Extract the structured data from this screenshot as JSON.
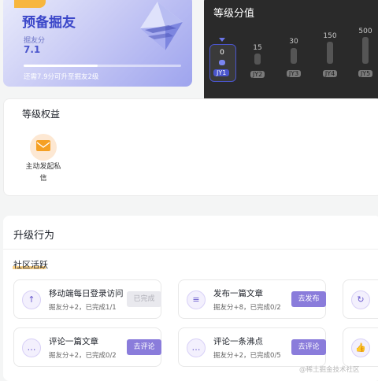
{
  "level_card": {
    "badge": "当前等级",
    "level_name": "预备掘友",
    "score_label": "掘友分",
    "score_value": "7.1",
    "progress": 0.47,
    "hint": "还需7.9分可升至掘友2级"
  },
  "score_panel": {
    "title": "等级分值",
    "current": {
      "value": "0",
      "tag": "JY1"
    },
    "levels": [
      {
        "value": "15",
        "tag": "JY2"
      },
      {
        "value": "30",
        "tag": "JY3"
      },
      {
        "value": "150",
        "tag": "JY4"
      },
      {
        "value": "500",
        "tag": "JY5"
      }
    ]
  },
  "benefits": {
    "title": "等级权益",
    "items": [
      {
        "label": "主动发起私信",
        "icon": "envelope-icon"
      }
    ]
  },
  "upgrade": {
    "title": "升级行为",
    "section": "社区活跃",
    "tasks": [
      {
        "name": "移动端每日登录访问",
        "desc": "掘友分+2，已完成1/1",
        "button": "已完成",
        "done": true,
        "icon": "login-icon"
      },
      {
        "name": "发布一篇文章",
        "desc": "掘友分+8，已完成0/2",
        "button": "去发布",
        "done": false,
        "icon": "article-icon"
      },
      {
        "name": "评论一篇文章",
        "desc": "掘友分+2，已完成0/2",
        "button": "去评论",
        "done": false,
        "icon": "comment-icon"
      },
      {
        "name": "评论一条沸点",
        "desc": "掘友分+2，已完成0/5",
        "button": "去评论",
        "done": false,
        "icon": "comment-icon"
      }
    ]
  },
  "watermark": "@稀土掘金技术社区"
}
